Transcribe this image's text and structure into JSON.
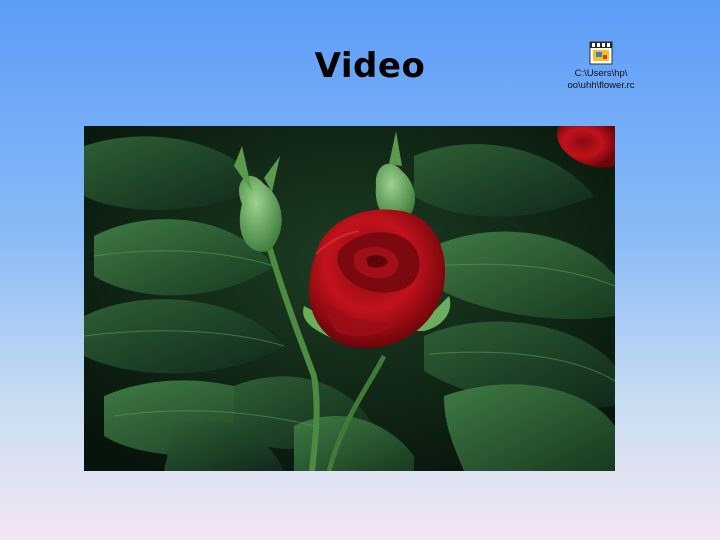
{
  "slide": {
    "title": "Video"
  },
  "file_shortcut": {
    "icon": "video-clip-icon",
    "path_line1": "C:\\Users\\hp\\",
    "path_line2": "oo\\uhh\\flower.rc"
  },
  "video": {
    "subject": "red-rose-bud-with-leaves"
  }
}
